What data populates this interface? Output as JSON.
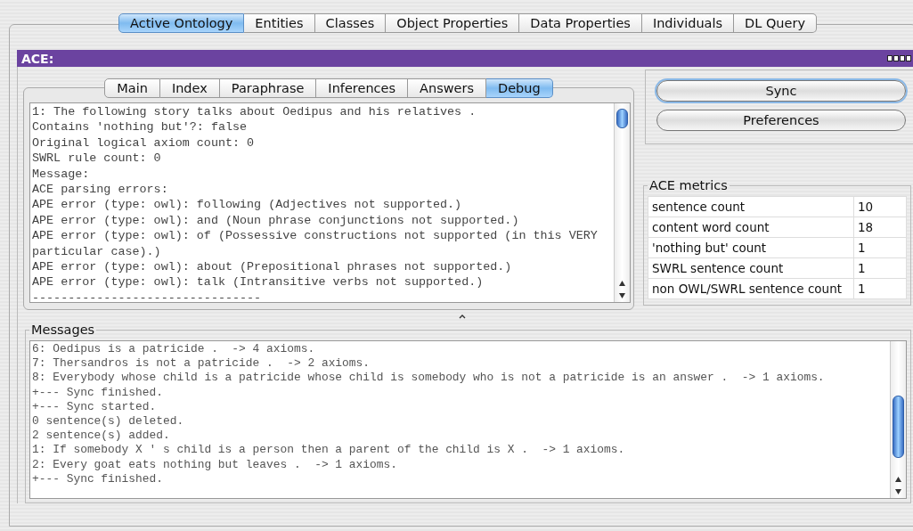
{
  "top_tabs": [
    {
      "label": "Active Ontology",
      "selected": true
    },
    {
      "label": "Entities",
      "selected": false
    },
    {
      "label": "Classes",
      "selected": false
    },
    {
      "label": "Object Properties",
      "selected": false
    },
    {
      "label": "Data Properties",
      "selected": false
    },
    {
      "label": "Individuals",
      "selected": false
    },
    {
      "label": "DL Query",
      "selected": false
    }
  ],
  "view": {
    "title": "ACE:"
  },
  "ace_tabs": [
    {
      "label": "Main",
      "selected": false
    },
    {
      "label": "Index",
      "selected": false
    },
    {
      "label": "Paraphrase",
      "selected": false
    },
    {
      "label": "Inferences",
      "selected": false
    },
    {
      "label": "Answers",
      "selected": false
    },
    {
      "label": "Debug",
      "selected": true
    }
  ],
  "debug_lines": [
    "1: The following story talks about Oedipus and his relatives .",
    "Contains 'nothing but'?: false",
    "Original logical axiom count: 0",
    "SWRL rule count: 0",
    "Message:",
    "ACE parsing errors:",
    "APE error (type: owl): following (Adjectives not supported.)",
    "APE error (type: owl): and (Noun phrase conjunctions not supported.)",
    "APE error (type: owl): of (Possessive constructions not supported (in this VERY particular case).)",
    "APE error (type: owl): about (Prepositional phrases not supported.)",
    "APE error (type: owl): talk (Intransitive verbs not supported.)",
    "--------------------------------"
  ],
  "buttons": [
    {
      "label": "Sync",
      "focused": true
    },
    {
      "label": "Preferences",
      "focused": false
    }
  ],
  "metrics": {
    "title": "ACE metrics",
    "rows": [
      {
        "label": "sentence count",
        "value": "10"
      },
      {
        "label": "content word count",
        "value": "18"
      },
      {
        "label": "'nothing but' count",
        "value": "1"
      },
      {
        "label": "SWRL sentence count",
        "value": "1"
      },
      {
        "label": "non OWL/SWRL sentence count",
        "value": "1"
      }
    ]
  },
  "messages": {
    "title": "Messages",
    "lines": [
      "6: Oedipus is a patricide .  -> 4 axioms.",
      "7: Thersandros is not a patricide .  -> 2 axioms.",
      "8: Everybody whose child is a patricide whose child is somebody who is not a patricide is an answer .  -> 1 axioms.",
      "+--- Sync finished.",
      "+--- Sync started.",
      "0 sentence(s) deleted.",
      "2 sentence(s) added.",
      "1: If somebody X ' s child is a person then a parent of the child is X .  -> 1 axioms.",
      "2: Every goat eats nothing but leaves .  -> 1 axioms.",
      "+--- Sync finished."
    ]
  }
}
